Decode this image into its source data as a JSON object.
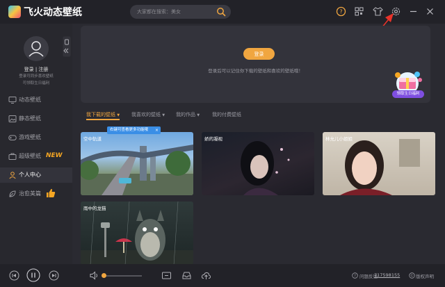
{
  "app": {
    "title": "飞火动态壁纸"
  },
  "search": {
    "placeholder": "大家都在搜索：美女"
  },
  "user": {
    "login": "登录 | 注册",
    "tip1": "登录可同步喜欢壁纸",
    "tip2": "可领取生日福利"
  },
  "sidebar": {
    "items": [
      {
        "label": "动态壁纸",
        "icon": "monitor-icon"
      },
      {
        "label": "静态壁纸",
        "icon": "image-icon"
      },
      {
        "label": "游戏壁纸",
        "icon": "gamepad-icon"
      },
      {
        "label": "超级壁纸",
        "icon": "briefcase-icon"
      },
      {
        "label": "个人中心",
        "icon": "user-icon"
      },
      {
        "label": "治愈美篇",
        "icon": "leaf-icon"
      }
    ],
    "new_badge": "NEW"
  },
  "banner": {
    "login_button": "登录",
    "message": "登录后可以记住你下载的壁纸和喜欢的壁纸哦！",
    "gift_label": "领取生日福利"
  },
  "tabs": [
    {
      "label": "我下载的壁纸"
    },
    {
      "label": "我喜欢的壁纸"
    },
    {
      "label": "我的作品"
    },
    {
      "label": "我的付费壁纸"
    }
  ],
  "tooltip": {
    "text": "右键可查看更多功能哦",
    "close": "×"
  },
  "wallpapers": [
    {
      "title": "空中轨道"
    },
    {
      "title": "娇的凝视"
    },
    {
      "title": "林允儿小姐姐"
    },
    {
      "title": "雨中的龙猫"
    }
  ],
  "footer": {
    "feedback_label": "问题反馈:",
    "feedback_number": "717598155",
    "copyright": "版权声明"
  },
  "colors": {
    "accent": "#f0a640",
    "background": "#2a2a31",
    "sidebar": "#28282e"
  }
}
